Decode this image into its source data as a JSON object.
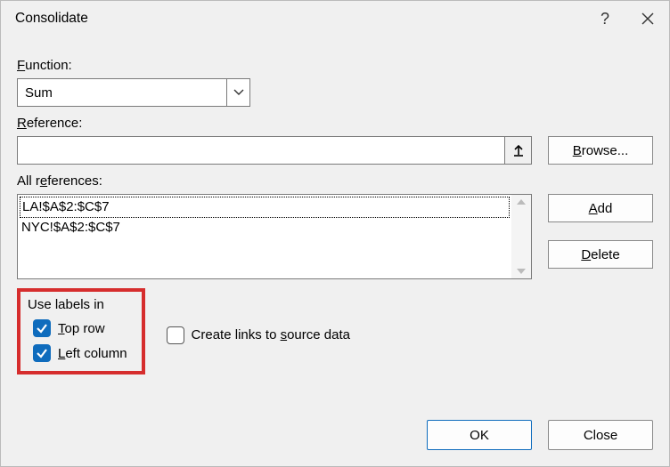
{
  "title": "Consolidate",
  "help_symbol": "?",
  "labels": {
    "function": "Function:",
    "reference": "Reference:",
    "all_references": "All references:",
    "use_labels_in": "Use labels in"
  },
  "function_select": {
    "value": "Sum"
  },
  "reference_input": "",
  "references": [
    "LA!$A$2:$C$7",
    "NYC!$A$2:$C$7"
  ],
  "buttons": {
    "browse": "Browse...",
    "add": "Add",
    "delete": "Delete",
    "ok": "OK",
    "close": "Close"
  },
  "checkboxes": {
    "top_row": {
      "label": "Top row",
      "checked": true
    },
    "left_column": {
      "label": "Left column",
      "checked": true
    },
    "create_links": {
      "label": "Create links to source data",
      "checked": false
    }
  }
}
